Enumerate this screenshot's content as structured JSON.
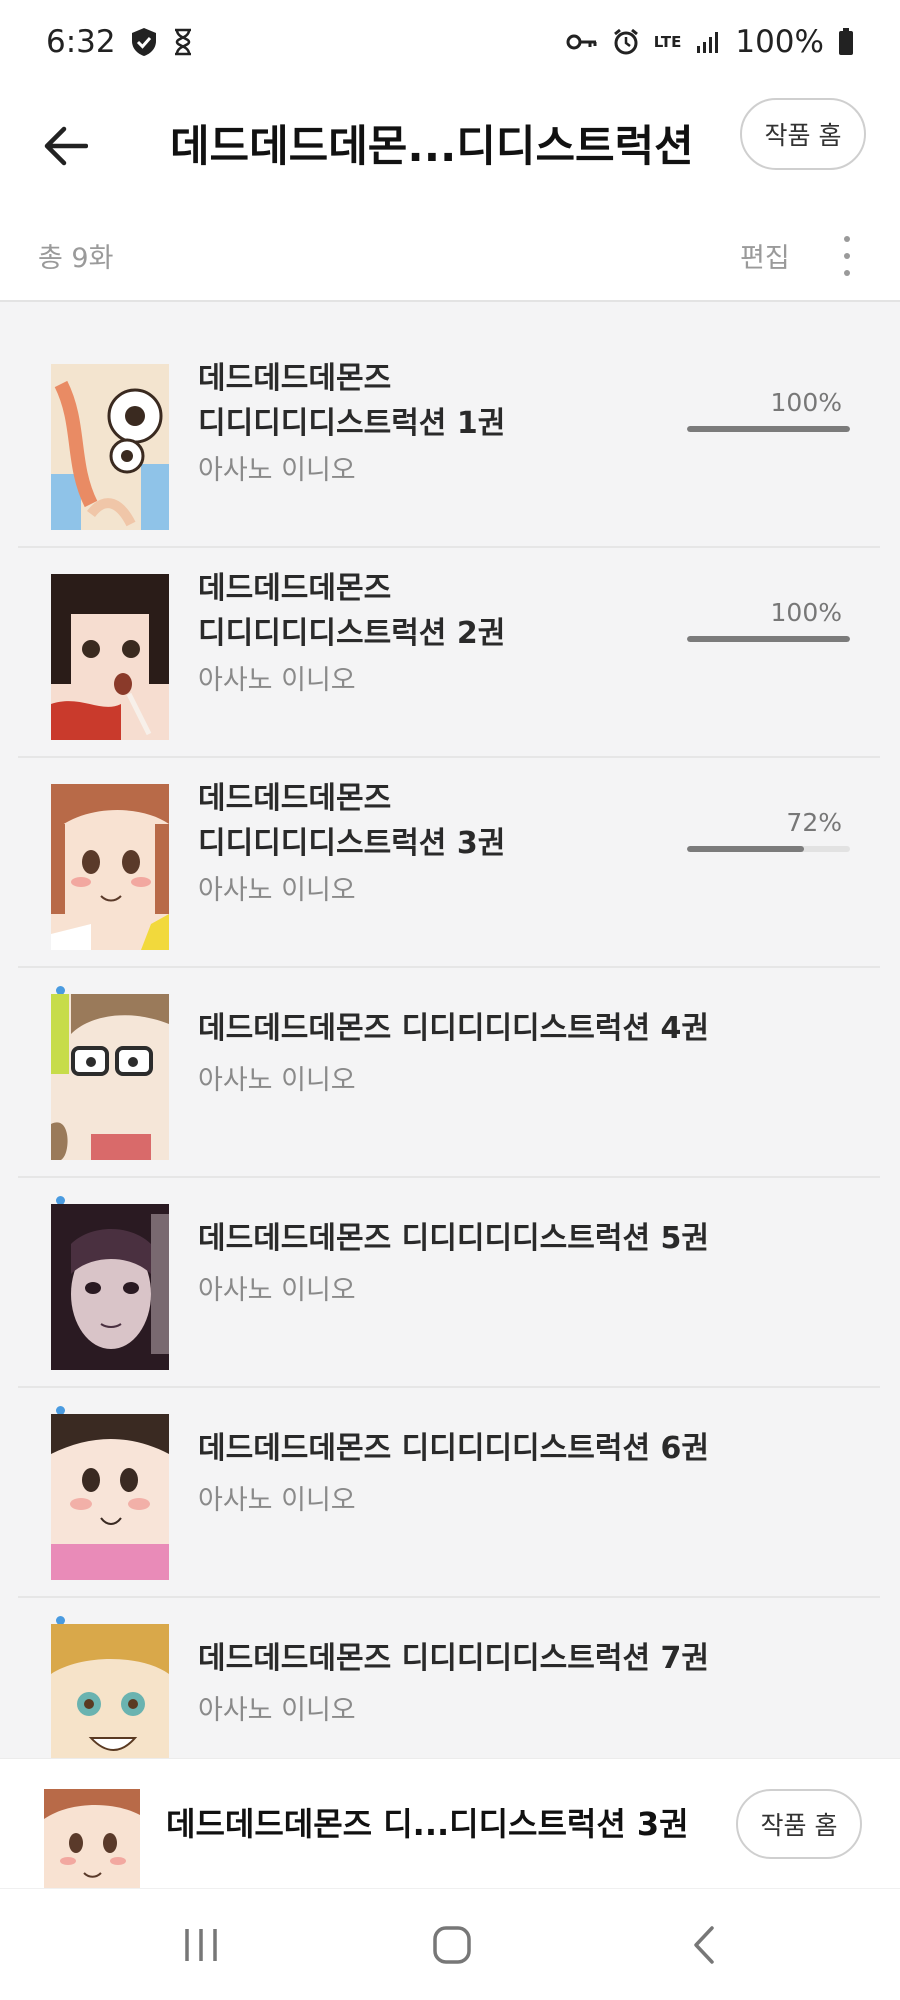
{
  "status_bar": {
    "time": "6:32",
    "network": "LTE",
    "battery": "100%"
  },
  "header": {
    "title": "데드데드데몬...디디스트럭션",
    "home_button": "작품 홈"
  },
  "subheader": {
    "count": "총 9화",
    "edit": "편집"
  },
  "items": [
    {
      "title_line1": "데드데드데몬즈",
      "title_line2": "디디디디디스트럭션 1권",
      "author": "아사노 이니오",
      "progress_label": "100%",
      "progress": 1.0,
      "is_new": false,
      "cover_palette": [
        "#f3e4cf",
        "#e98b64",
        "#8fc3e8",
        "#3a2a20"
      ]
    },
    {
      "title_line1": "데드데드데몬즈",
      "title_line2": "디디디디디스트럭션 2권",
      "author": "아사노 이니오",
      "progress_label": "100%",
      "progress": 1.0,
      "is_new": false,
      "cover_palette": [
        "#f6ddd0",
        "#c93a2c",
        "#2a1c18",
        "#f7f0ea"
      ]
    },
    {
      "title_line1": "데드데드데몬즈",
      "title_line2": "디디디디디스트럭션 3권",
      "author": "아사노 이니오",
      "progress_label": "72%",
      "progress": 0.72,
      "is_new": false,
      "cover_palette": [
        "#f8e2d2",
        "#b86a48",
        "#f2d93c",
        "#5a3a2a"
      ]
    },
    {
      "title": "데드데드데몬즈 디디디디디스트럭션 4권",
      "author": "아사노 이니오",
      "is_new": true,
      "cover_palette": [
        "#f5e6d8",
        "#c7dc4a",
        "#2c2c2c",
        "#9a7a5a"
      ]
    },
    {
      "title": "데드데드데몬즈 디디디디디스트럭션 5권",
      "author": "아사노 이니오",
      "is_new": true,
      "cover_palette": [
        "#2a1a22",
        "#d9c4c8",
        "#4a3040",
        "#efe2e6"
      ]
    },
    {
      "title": "데드데드데몬즈 디디디디디스트럭션 6권",
      "author": "아사노 이니오",
      "is_new": true,
      "cover_palette": [
        "#f8e4d8",
        "#e98bb8",
        "#3a2a22",
        "#f2b0a8"
      ]
    },
    {
      "title": "데드데드데몬즈 디디디디디스트럭션 7권",
      "author": "아사노 이니오",
      "is_new": true,
      "cover_palette": [
        "#f6e3c9",
        "#d9a84a",
        "#6ab3b0",
        "#5a3a22"
      ]
    }
  ],
  "mini_player": {
    "title": "데드데드데몬즈 디...디디스트럭션 3권",
    "home_button": "작품 홈"
  },
  "colors": {
    "list_background": "#f4f4f5",
    "progress_fill": "#7b7b7b",
    "new_dot": "#4a9be0"
  },
  "icons": {
    "back": "arrow-left-icon",
    "more": "more-vertical-icon",
    "nav_recents": "recents-icon",
    "nav_home": "home-icon",
    "nav_back": "back-chevron-icon"
  }
}
